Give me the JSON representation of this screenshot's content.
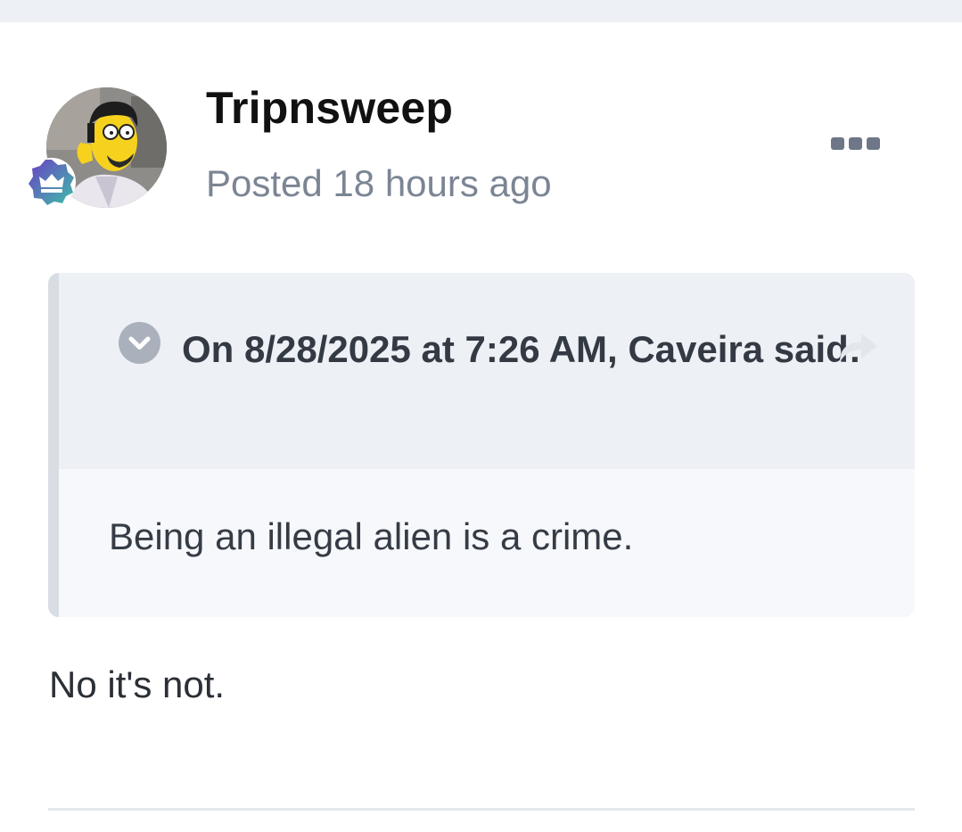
{
  "post": {
    "author": "Tripnsweep",
    "posted_time": "Posted 18 hours ago",
    "quote": {
      "citation": "On 8/28/2025 at 7:26 AM, Caveira said:",
      "text": "Being an illegal alien is a crime."
    },
    "reply_text": "No it's not."
  },
  "icons": {
    "more": "ellipsis-icon",
    "collapse": "chevron-down-icon",
    "share": "share-arrow-icon",
    "badge": "crown-badge-icon"
  },
  "colors": {
    "badge_gradient_start": "#6a3fc4",
    "badge_gradient_end": "#3fbfa8",
    "timestamp": "#7b8594",
    "quote_header_bg": "#edf0f4"
  }
}
